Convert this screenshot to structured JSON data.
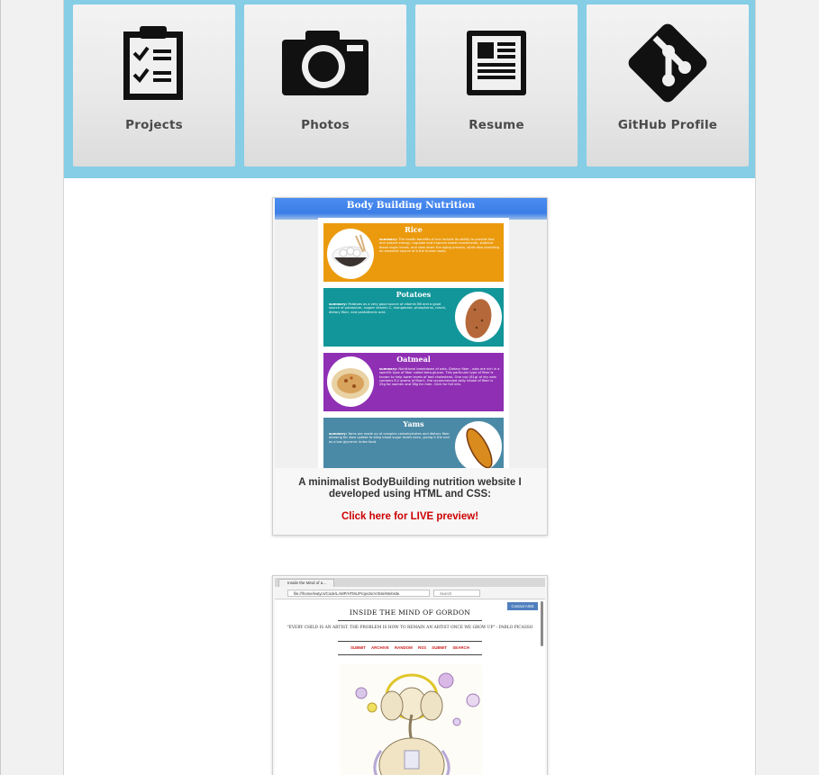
{
  "nav": {
    "tiles": [
      {
        "label": "Projects",
        "icon": "clipboard-checklist-icon"
      },
      {
        "label": "Photos",
        "icon": "camera-icon"
      },
      {
        "label": "Resume",
        "icon": "document-icon"
      },
      {
        "label": "GitHub Profile",
        "icon": "git-logo-icon"
      }
    ]
  },
  "projects": [
    {
      "screenshot": {
        "header_title": "Body Building Nutrition",
        "foods": [
          {
            "name": "Rice",
            "color": "#eb9a0e",
            "summary_label": "summary:",
            "summary": "The health benefits of rice include its ability to provide fast and instant energy, regulate and improve bowel movements, stabilize blood sugar levels, and slow down the aging process, while also providing an essential source of b the human body."
          },
          {
            "name": "Potatoes",
            "color": "#12969a",
            "summary_label": "summary:",
            "summary": "Potatoes as a very good source of vitamin B6 and a good source of potassium, copper vitamin C, manganese, phosphorus, niacin, dietary fiber, and pantothenic acid."
          },
          {
            "name": "Oatmeal",
            "color": "#8f2fb4",
            "summary_label": "summary:",
            "summary": "Nutritional breakdown of oats. Dietary fiber - oats are rich in a specific type of fiber called beta-glucan. This particular type of fiber is known to help lower levels of bad cholesterol. One cup (81g) of dry oats contains 8.2 grams of fiber1, the recommended daily intake of fiber is 25g for women and 38g for men. Click for full info."
          },
          {
            "name": "Yams",
            "color": "#4b8aa6",
            "summary_label": "summary:",
            "summary": "Yams are made up of complex carbohydrates and dietary fiber allowing for slow uptake to keep blood sugar levels even, giving it the nod as a low glycemic index food."
          }
        ]
      },
      "caption": "A minimalist BodyBuilding nutrition website I developed using HTML and CSS:",
      "link_text": "Click here for LIVE preview!"
    },
    {
      "screenshot": {
        "tab_title": "Inside the Mind of a…",
        "url": "file:///home/leatycs/Code/LAMP/HTML/Projects/ArtSite/Website.",
        "search_placeholder": "Search",
        "contact_label": "Contact Artist",
        "site_title": "INSIDE THE MIND OF GORDON",
        "quote": "\"EVERY CHILD IS AN ARTIST. THE PROBLEM IS HOW TO REMAIN AN ARTIST ONCE WE GROW UP\" - PABLO PICASSO",
        "nav_items": [
          "SUBMIT",
          "ARCHIVE",
          "RANDOM",
          "RSS",
          "SUBMIT",
          "SEARCH"
        ]
      }
    }
  ],
  "colors": {
    "nav_band": "#86cde6",
    "link_red": "#cc0000"
  }
}
